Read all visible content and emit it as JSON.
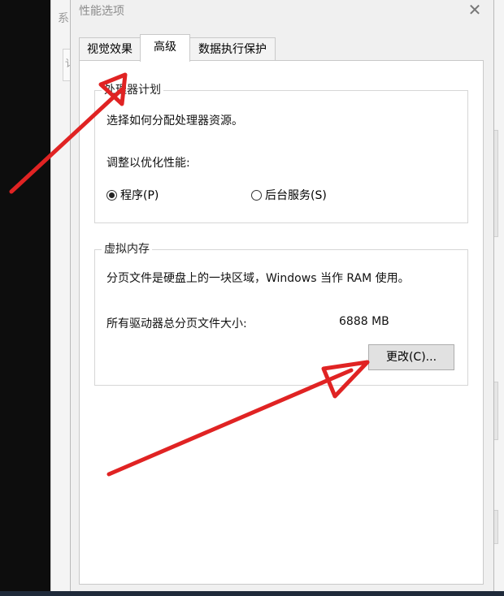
{
  "background_window": {
    "title_fragment": "系",
    "tab_fragment": "讠"
  },
  "dialog": {
    "title": "性能选项",
    "close_glyph": "✕",
    "tabs": [
      {
        "label": "视觉效果",
        "active": false
      },
      {
        "label": "高级",
        "active": true
      },
      {
        "label": "数据执行保护",
        "active": false
      }
    ]
  },
  "processor": {
    "legend": "处理器计划",
    "description": "选择如何分配处理器资源。",
    "optimize_label": "调整以优化性能:",
    "options": [
      {
        "label": "程序(P)",
        "checked": true
      },
      {
        "label": "后台服务(S)",
        "checked": false
      }
    ]
  },
  "virtual_memory": {
    "legend": "虚拟内存",
    "description": "分页文件是硬盘上的一块区域，Windows 当作 RAM 使用。",
    "total_label": "所有驱动器总分页文件大小:",
    "total_value": "6888 MB",
    "change_button": "更改(C)..."
  },
  "colors": {
    "annotation_arrow": "#e02323",
    "accent": "#333333"
  }
}
